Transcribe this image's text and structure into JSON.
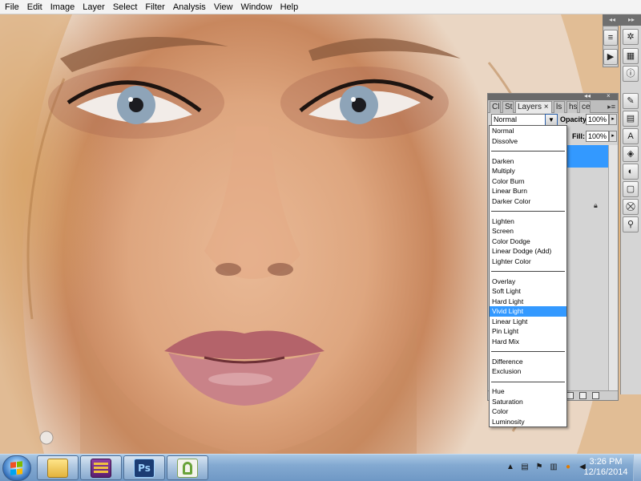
{
  "menubar": {
    "items": [
      "File",
      "Edit",
      "Image",
      "Layer",
      "Select",
      "Filter",
      "Analysis",
      "View",
      "Window",
      "Help"
    ]
  },
  "layers_panel": {
    "tabs": [
      "Cl",
      "St",
      "Layers",
      "ls",
      "hs",
      "ce"
    ],
    "active_tab": "Layers",
    "tab_close": "×",
    "blend_mode_value": "Normal",
    "opacity_label": "Opacity:",
    "opacity_value": "100%",
    "fill_label": "Fill:",
    "fill_value": "100%"
  },
  "blend_menu": {
    "groups": [
      [
        "Normal",
        "Dissolve"
      ],
      [
        "Darken",
        "Multiply",
        "Color Burn",
        "Linear Burn",
        "Darker Color"
      ],
      [
        "Lighten",
        "Screen",
        "Color Dodge",
        "Linear Dodge (Add)",
        "Lighter Color"
      ],
      [
        "Overlay",
        "Soft Light",
        "Hard Light",
        "Vivid Light",
        "Linear Light",
        "Pin Light",
        "Hard Mix"
      ],
      [
        "Difference",
        "Exclusion"
      ],
      [
        "Hue",
        "Saturation",
        "Color",
        "Luminosity"
      ]
    ],
    "highlighted": "Vivid Light"
  },
  "taskbar": {
    "apps": [
      {
        "name": "windows-explorer",
        "label": ""
      },
      {
        "name": "winrar",
        "label": ""
      },
      {
        "name": "photoshop",
        "label": "Ps"
      },
      {
        "name": "greenshot",
        "label": ""
      }
    ],
    "clock_time": "3:26 PM",
    "clock_date": "12/16/2014"
  },
  "colors": {
    "selection_blue": "#3399ff",
    "photoshop_blue": "#1b3c73",
    "photoshop_text": "#9fd3ff"
  }
}
